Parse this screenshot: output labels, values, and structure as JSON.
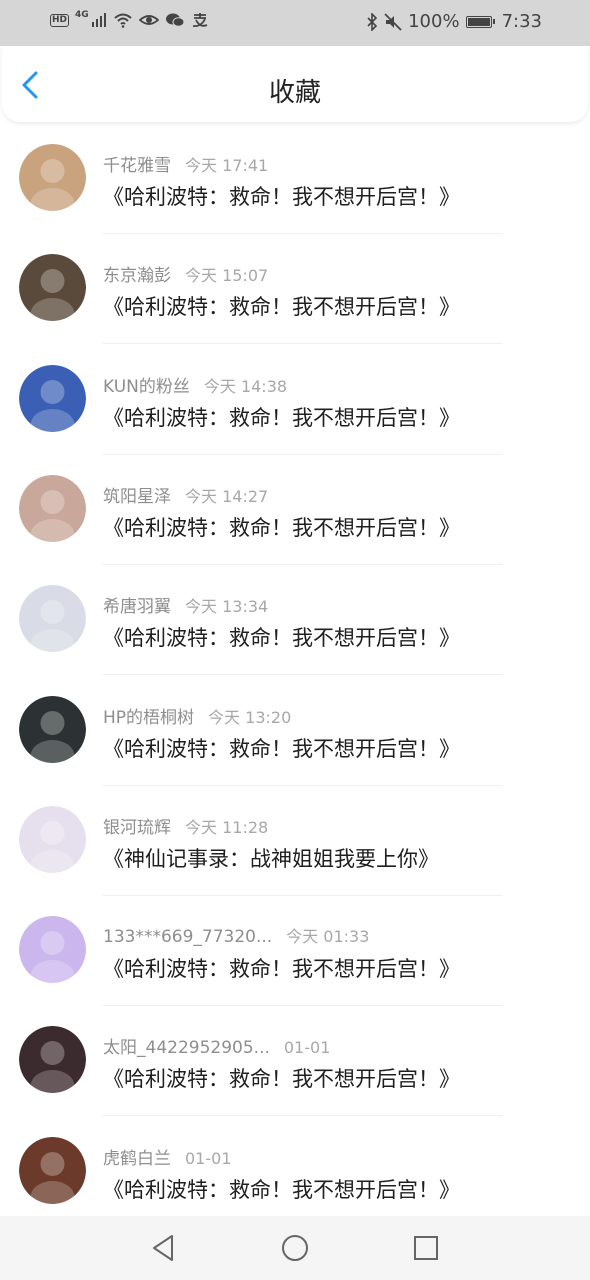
{
  "status_bar": {
    "network": "4G",
    "battery": "100%",
    "time": "7:33",
    "icons_left": [
      "hd-icon",
      "signal-icon",
      "wifi-icon",
      "eye-icon",
      "wechat-icon",
      "alipay-icon"
    ],
    "icons_right": [
      "bluetooth-icon",
      "mute-icon",
      "battery-icon"
    ]
  },
  "header": {
    "title": "收藏"
  },
  "items": [
    {
      "author": "千花雅雪",
      "time": "今天 17:41",
      "title": "《哈利波特：救命！我不想开后宫！》",
      "avatar_color": "#c9a27e"
    },
    {
      "author": "东京瀚彭",
      "time": "今天 15:07",
      "title": "《哈利波特：救命！我不想开后宫！》",
      "avatar_color": "#5a4a3b"
    },
    {
      "author": "KUN的粉丝",
      "time": "今天 14:38",
      "title": "《哈利波特：救命！我不想开后宫！》",
      "avatar_color": "#3a5fb5"
    },
    {
      "author": "筑阳星泽",
      "time": "今天 14:27",
      "title": "《哈利波特：救命！我不想开后宫！》",
      "avatar_color": "#c9a79a"
    },
    {
      "author": "希唐羽翼",
      "time": "今天 13:34",
      "title": "《哈利波特：救命！我不想开后宫！》",
      "avatar_color": "#d9dbe6"
    },
    {
      "author": "HP的梧桐树",
      "time": "今天 13:20",
      "title": "《哈利波特：救命！我不想开后宫！》",
      "avatar_color": "#2c3233"
    },
    {
      "author": "银河琉辉",
      "time": "今天 11:28",
      "title": "《神仙记事录：战神姐姐我要上你》",
      "avatar_color": "#e6e0ee"
    },
    {
      "author": "133***669_77320...",
      "time": "今天 01:33",
      "title": "《哈利波特：救命！我不想开后宫！》",
      "avatar_color": "#cbb6ee"
    },
    {
      "author": "太阳_4422952905...",
      "time": "01-01",
      "title": "《哈利波特：救命！我不想开后宫！》",
      "avatar_color": "#3b2a2e"
    },
    {
      "author": "虎鹤白兰",
      "time": "01-01",
      "title": "《哈利波特：救命！我不想开后宫！》",
      "avatar_color": "#6b3a2a"
    }
  ],
  "nav": {
    "back": "back-nav-icon",
    "home": "home-nav-icon",
    "recents": "recents-nav-icon"
  },
  "colors": {
    "accent": "#2196f3",
    "status_bar_bg": "#d6d6d6",
    "nav_bg": "#f5f5f5"
  }
}
